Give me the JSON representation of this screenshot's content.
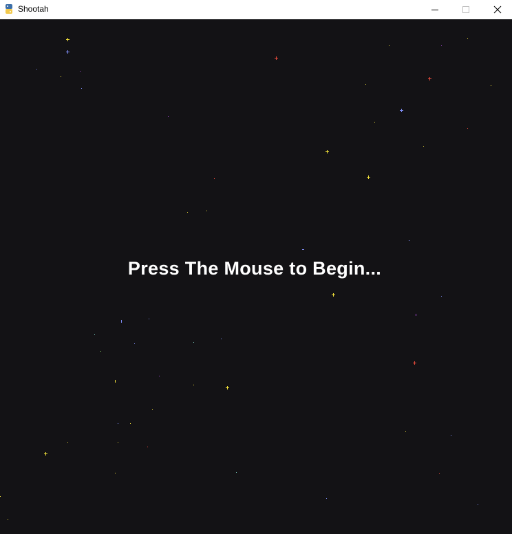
{
  "window": {
    "title": "Shootah",
    "app_icon": "python-snake-icon",
    "controls": [
      "minimize",
      "maximize",
      "close"
    ]
  },
  "game": {
    "prompt": "Press The Mouse to Begin...",
    "background_color": "#131215",
    "star_colors": {
      "yellow": "#f2e13a",
      "blue": "#7f8df5",
      "red": "#e74a3b",
      "purple": "#a24ad0",
      "teal": "#7fd6c8",
      "green": "#8bd86a"
    }
  }
}
